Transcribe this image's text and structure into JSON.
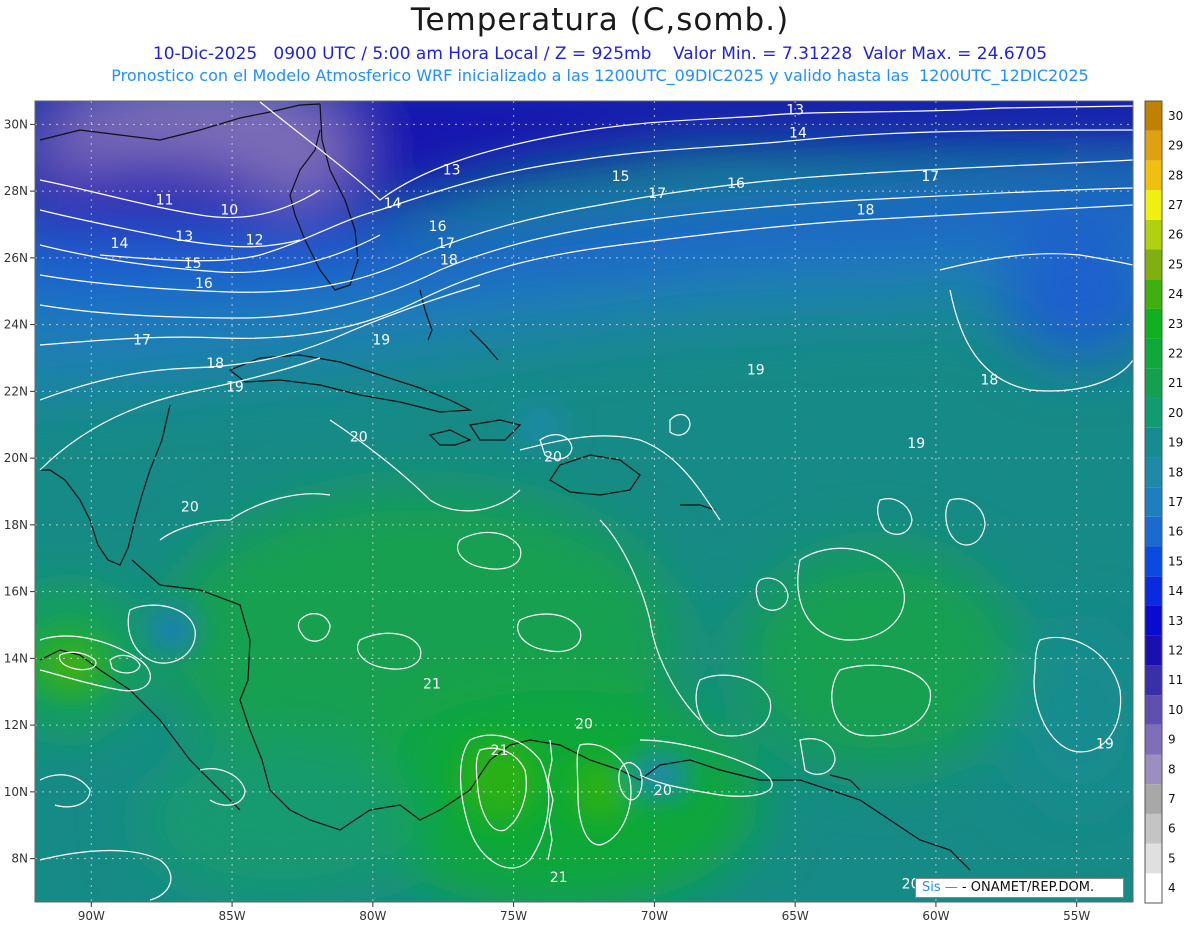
{
  "header": {
    "title": "Temperatura (C,somb.)",
    "line1": "10-Dic-2025   0900 UTC / 5:00 am Hora Local / Z = 925mb    Valor Min. = 7.31228  Valor Max. = 24.6705",
    "line2": "Pronostico con el Modelo Atmosferico WRF inicializado a las 1200UTC_09DIC2025 y valido hasta las  1200UTC_12DIC2025"
  },
  "credit": {
    "brand": "Sis",
    "text": "- ONAMET/REP.DOM."
  },
  "chart_data": {
    "type": "heatmap",
    "title": "Temperatura (C,somb.)",
    "valid_time": "10-Dic-2025 0900 UTC",
    "local_time": "5:00 am Hora Local",
    "level": "Z = 925mb",
    "min_value": 7.31228,
    "max_value": 24.6705,
    "lat_ticks": [
      "30N",
      "28N",
      "26N",
      "24N",
      "22N",
      "20N",
      "18N",
      "16N",
      "14N",
      "12N",
      "10N",
      "8N"
    ],
    "lon_ticks": [
      "90W",
      "85W",
      "80W",
      "75W",
      "70W",
      "65W",
      "60W",
      "55W"
    ],
    "lat_values": [
      30,
      28,
      26,
      24,
      22,
      20,
      18,
      16,
      14,
      12,
      10,
      8
    ],
    "lon_values": [
      -90,
      -85,
      -80,
      -75,
      -70,
      -65,
      -60,
      -55
    ],
    "lat_range": [
      6.7,
      30.7
    ],
    "lon_range": [
      -92,
      -53
    ],
    "grid": true,
    "colorbar": {
      "placement": "right",
      "labels": [
        "4",
        "5",
        "6",
        "7",
        "8",
        "9",
        "10",
        "11",
        "12",
        "13",
        "14",
        "15",
        "16",
        "17",
        "18",
        "19",
        "20",
        "21",
        "22",
        "23",
        "24",
        "25",
        "26",
        "27",
        "28",
        "29",
        "30"
      ],
      "colors": [
        "#ffffff",
        "#e0e0e0",
        "#c4c4c4",
        "#a8a8a8",
        "#9b8fc0",
        "#7f6fb8",
        "#5f4fb0",
        "#3a2fa8",
        "#1a0fb0",
        "#0a0ad0",
        "#0a2ae0",
        "#0a4ae0",
        "#1a6ad0",
        "#1e7fc0",
        "#1e8aa8",
        "#168c90",
        "#129a70",
        "#14a050",
        "#10a83a",
        "#10b020",
        "#40b010",
        "#80b010",
        "#b0d010",
        "#f0f010",
        "#f0c010",
        "#e0a010",
        "#c08000"
      ]
    },
    "contour_labels": [
      {
        "value": "13",
        "lon": -65.0,
        "lat": 30.3
      },
      {
        "value": "14",
        "lon": -64.9,
        "lat": 29.6
      },
      {
        "value": "13",
        "lon": -77.2,
        "lat": 28.5
      },
      {
        "value": "15",
        "lon": -71.2,
        "lat": 28.3
      },
      {
        "value": "16",
        "lon": -67.1,
        "lat": 28.1
      },
      {
        "value": "17",
        "lon": -60.2,
        "lat": 28.3
      },
      {
        "value": "17",
        "lon": -69.9,
        "lat": 27.8
      },
      {
        "value": "18",
        "lon": -62.5,
        "lat": 27.3
      },
      {
        "value": "11",
        "lon": -87.4,
        "lat": 27.6
      },
      {
        "value": "10",
        "lon": -85.1,
        "lat": 27.3
      },
      {
        "value": "14",
        "lon": -79.3,
        "lat": 27.5
      },
      {
        "value": "13",
        "lon": -86.7,
        "lat": 26.5
      },
      {
        "value": "12",
        "lon": -84.2,
        "lat": 26.4
      },
      {
        "value": "16",
        "lon": -77.7,
        "lat": 26.8
      },
      {
        "value": "17",
        "lon": -77.4,
        "lat": 26.3
      },
      {
        "value": "18",
        "lon": -77.3,
        "lat": 25.8
      },
      {
        "value": "14",
        "lon": -89.0,
        "lat": 26.3
      },
      {
        "value": "15",
        "lon": -86.4,
        "lat": 25.7
      },
      {
        "value": "16",
        "lon": -86.0,
        "lat": 25.1
      },
      {
        "value": "17",
        "lon": -88.2,
        "lat": 23.4
      },
      {
        "value": "19",
        "lon": -79.7,
        "lat": 23.4
      },
      {
        "value": "18",
        "lon": -85.6,
        "lat": 22.7
      },
      {
        "value": "19",
        "lon": -84.9,
        "lat": 22.0
      },
      {
        "value": "19",
        "lon": -66.4,
        "lat": 22.5
      },
      {
        "value": "18",
        "lon": -58.1,
        "lat": 22.2
      },
      {
        "value": "20",
        "lon": -80.5,
        "lat": 20.5
      },
      {
        "value": "19",
        "lon": -60.7,
        "lat": 20.3
      },
      {
        "value": "20",
        "lon": -73.6,
        "lat": 19.9
      },
      {
        "value": "20",
        "lon": -86.5,
        "lat": 18.4
      },
      {
        "value": "21",
        "lon": -77.9,
        "lat": 13.1
      },
      {
        "value": "20",
        "lon": -72.5,
        "lat": 11.9
      },
      {
        "value": "21",
        "lon": -75.5,
        "lat": 11.1
      },
      {
        "value": "19",
        "lon": -54.0,
        "lat": 11.3
      },
      {
        "value": "20",
        "lon": -69.7,
        "lat": 9.9
      },
      {
        "value": "21",
        "lon": -73.4,
        "lat": 7.3
      },
      {
        "value": "20",
        "lon": -60.9,
        "lat": 7.1
      }
    ]
  }
}
